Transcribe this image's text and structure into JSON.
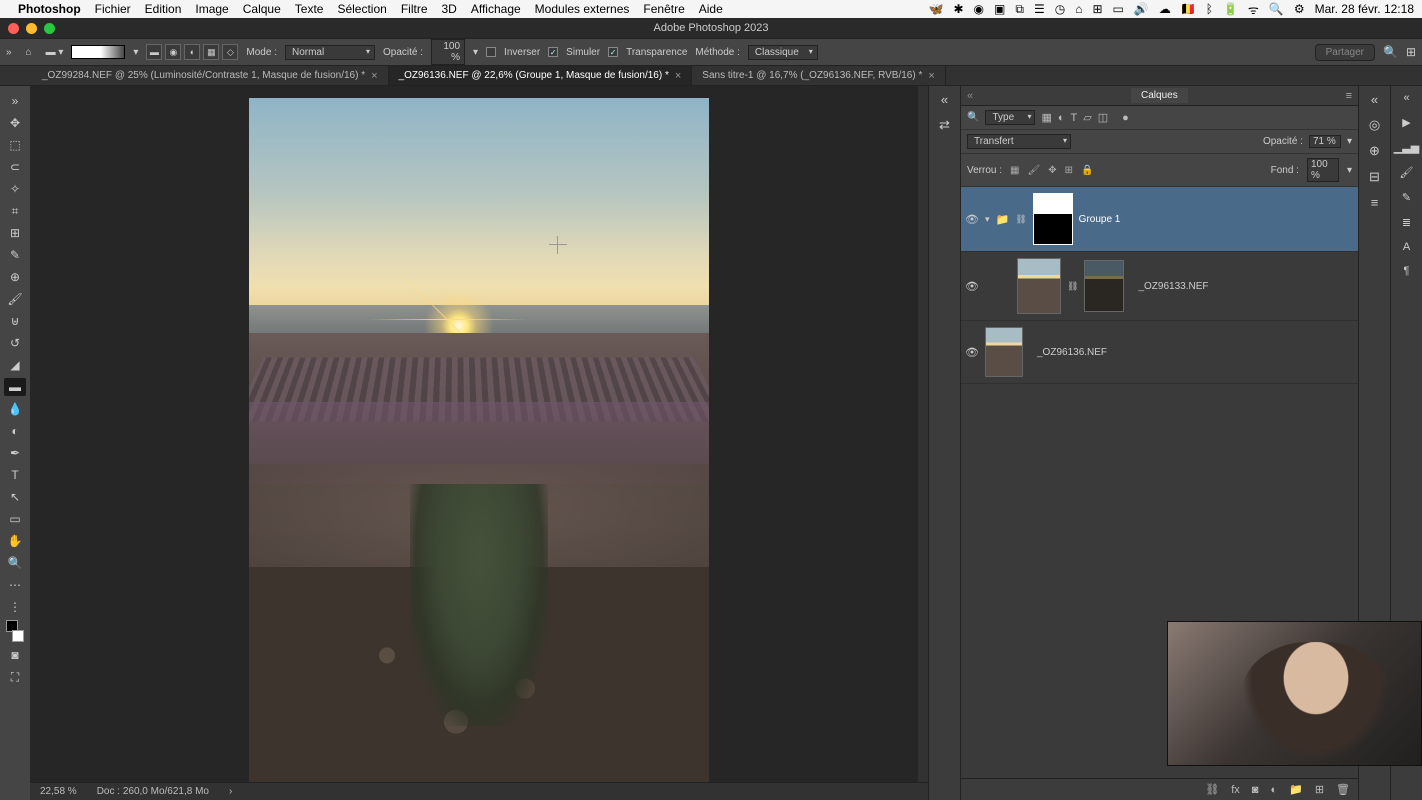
{
  "mac_menu": {
    "app": "Photoshop",
    "items": [
      "Fichier",
      "Edition",
      "Image",
      "Calque",
      "Texte",
      "Sélection",
      "Filtre",
      "3D",
      "Affichage",
      "Modules externes",
      "Fenêtre",
      "Aide"
    ],
    "clock": "Mar. 28 févr.  12:18"
  },
  "window_title": "Adobe Photoshop 2023",
  "options": {
    "mode_label": "Mode :",
    "mode_value": "Normal",
    "opacity_label": "Opacité :",
    "opacity_value": "100 %",
    "inverser": "Inverser",
    "simuler": "Simuler",
    "transparence": "Transparence",
    "methode_label": "Méthode :",
    "methode_value": "Classique",
    "share": "Partager"
  },
  "tabs": [
    {
      "label": "_OZ99284.NEF @ 25% (Luminosité/Contraste 1, Masque de fusion/16) *",
      "active": false
    },
    {
      "label": "_OZ96136.NEF @ 22,6% (Groupe 1, Masque de fusion/16) *",
      "active": true
    },
    {
      "label": "Sans titre-1 @ 16,7% (_OZ96136.NEF, RVB/16) *",
      "active": false
    }
  ],
  "status": {
    "zoom": "22,58 %",
    "doc": "Doc : 260,0 Mo/621,8 Mo"
  },
  "layers_panel": {
    "tab": "Calques",
    "filter_label": "Type",
    "blend_mode": "Transfert",
    "opacity_label": "Opacité :",
    "opacity_value": "71 %",
    "lock_label": "Verrou :",
    "fill_label": "Fond :",
    "fill_value": "100 %",
    "layers": [
      {
        "name": "Groupe 1",
        "type": "group",
        "selected": true
      },
      {
        "name": "_OZ96133.NEF",
        "type": "layer"
      },
      {
        "name": "_OZ96136.NEF",
        "type": "base"
      }
    ]
  }
}
